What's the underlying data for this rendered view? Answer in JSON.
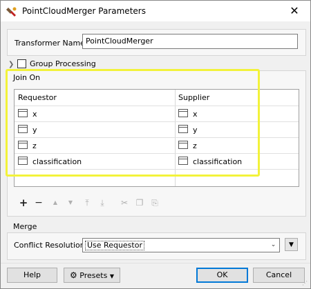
{
  "window": {
    "title": "PointCloudMerger Parameters",
    "close_glyph": "✕"
  },
  "transformer": {
    "label": "Transformer Name:",
    "value": "PointCloudMerger"
  },
  "group_processing": {
    "label": "Group Processing",
    "checked": false
  },
  "join_on": {
    "title": "Join On",
    "columns": [
      "Requestor",
      "Supplier"
    ],
    "rows": [
      {
        "requestor": "x",
        "supplier": "x"
      },
      {
        "requestor": "y",
        "supplier": "y"
      },
      {
        "requestor": "z",
        "supplier": "z"
      },
      {
        "requestor": "classification",
        "supplier": "classification"
      }
    ],
    "toolbar": [
      {
        "icon": "plus-icon",
        "glyph": "+",
        "enabled": true
      },
      {
        "icon": "minus-icon",
        "glyph": "−",
        "enabled": true
      },
      {
        "icon": "move-up-icon",
        "glyph": "▲",
        "enabled": false
      },
      {
        "icon": "move-down-icon",
        "glyph": "▼",
        "enabled": false
      },
      {
        "icon": "move-top-icon",
        "glyph": "⤒",
        "enabled": false
      },
      {
        "icon": "move-bottom-icon",
        "glyph": "⤓",
        "enabled": false
      },
      {
        "icon": "cut-icon",
        "glyph": "✂",
        "enabled": false
      },
      {
        "icon": "copy-icon",
        "glyph": "❐",
        "enabled": false
      },
      {
        "icon": "paste-icon",
        "glyph": "⎘",
        "enabled": false
      }
    ]
  },
  "merge": {
    "title": "Merge",
    "conflict_label": "Conflict Resolution:",
    "conflict_value": "Use Requestor"
  },
  "buttons": {
    "help": "Help",
    "presets": "Presets",
    "ok": "OK",
    "cancel": "Cancel"
  },
  "colors": {
    "highlight": "#f2f23a",
    "ok_border": "#0078d7",
    "dialog_bg": "#f0f0f0"
  }
}
